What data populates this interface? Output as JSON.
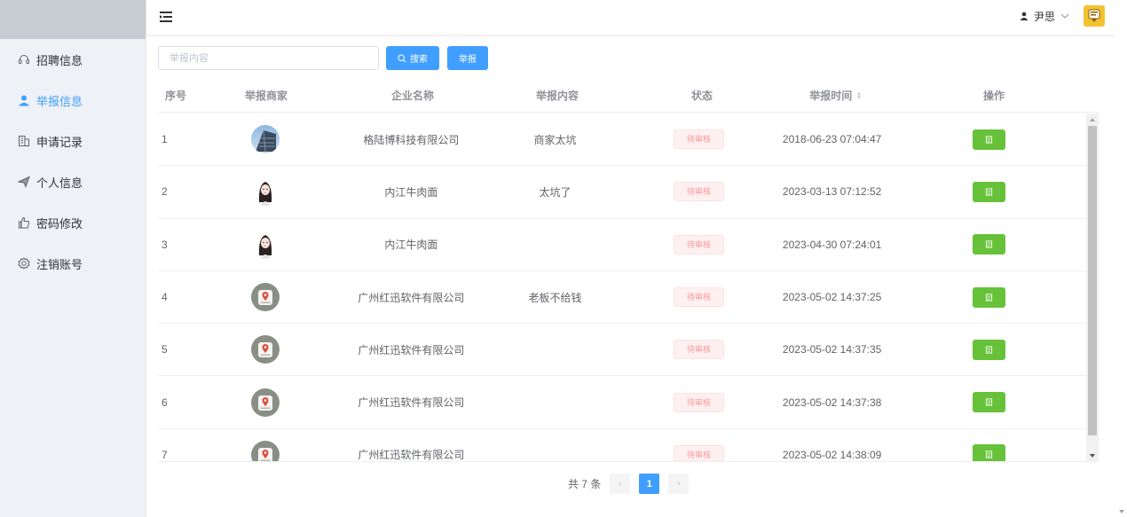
{
  "sidebar": {
    "items": [
      {
        "label": "招聘信息",
        "icon": "headset-icon",
        "active": false
      },
      {
        "label": "举报信息",
        "icon": "user-icon",
        "active": true
      },
      {
        "label": "申请记录",
        "icon": "building-icon",
        "active": false
      },
      {
        "label": "个人信息",
        "icon": "send-icon",
        "active": false
      },
      {
        "label": "密码修改",
        "icon": "hand-icon",
        "active": false
      },
      {
        "label": "注销账号",
        "icon": "settings-icon",
        "active": false
      }
    ]
  },
  "header": {
    "username": "尹思"
  },
  "toolbar": {
    "search_placeholder": "举报内容",
    "search_label": "搜索",
    "report_label": "举报"
  },
  "table": {
    "columns": [
      "序号",
      "举报商家",
      "企业名称",
      "举报内容",
      "状态",
      "举报时间",
      "操作"
    ],
    "rows": [
      {
        "idx": "1",
        "avatar": "building",
        "company": "格陆博科技有限公司",
        "content": "商家太坑",
        "status": "待审核",
        "time": "2018-06-23 07:04:47"
      },
      {
        "idx": "2",
        "avatar": "girl",
        "company": "内江牛肉面",
        "content": "太坑了",
        "status": "待审核",
        "time": "2023-03-13 07:12:52"
      },
      {
        "idx": "3",
        "avatar": "girl",
        "company": "内江牛肉面",
        "content": "",
        "status": "待审核",
        "time": "2023-04-30 07:24:01"
      },
      {
        "idx": "4",
        "avatar": "map",
        "company": "广州红迅软件有限公司",
        "content": "老板不给钱",
        "status": "待审核",
        "time": "2023-05-02 14:37:25"
      },
      {
        "idx": "5",
        "avatar": "map",
        "company": "广州红迅软件有限公司",
        "content": "",
        "status": "待审核",
        "time": "2023-05-02 14:37:35"
      },
      {
        "idx": "6",
        "avatar": "map",
        "company": "广州红迅软件有限公司",
        "content": "",
        "status": "待审核",
        "time": "2023-05-02 14:37:38"
      },
      {
        "idx": "7",
        "avatar": "map",
        "company": "广州红迅软件有限公司",
        "content": "",
        "status": "待审核",
        "time": "2023-05-02 14:38:09"
      }
    ]
  },
  "pagination": {
    "total_text": "共 7 条",
    "current_page": "1",
    "prev": "‹",
    "next": "›"
  },
  "colors": {
    "primary": "#409eff",
    "success": "#67c23a",
    "danger_light": "#fef0f0"
  }
}
